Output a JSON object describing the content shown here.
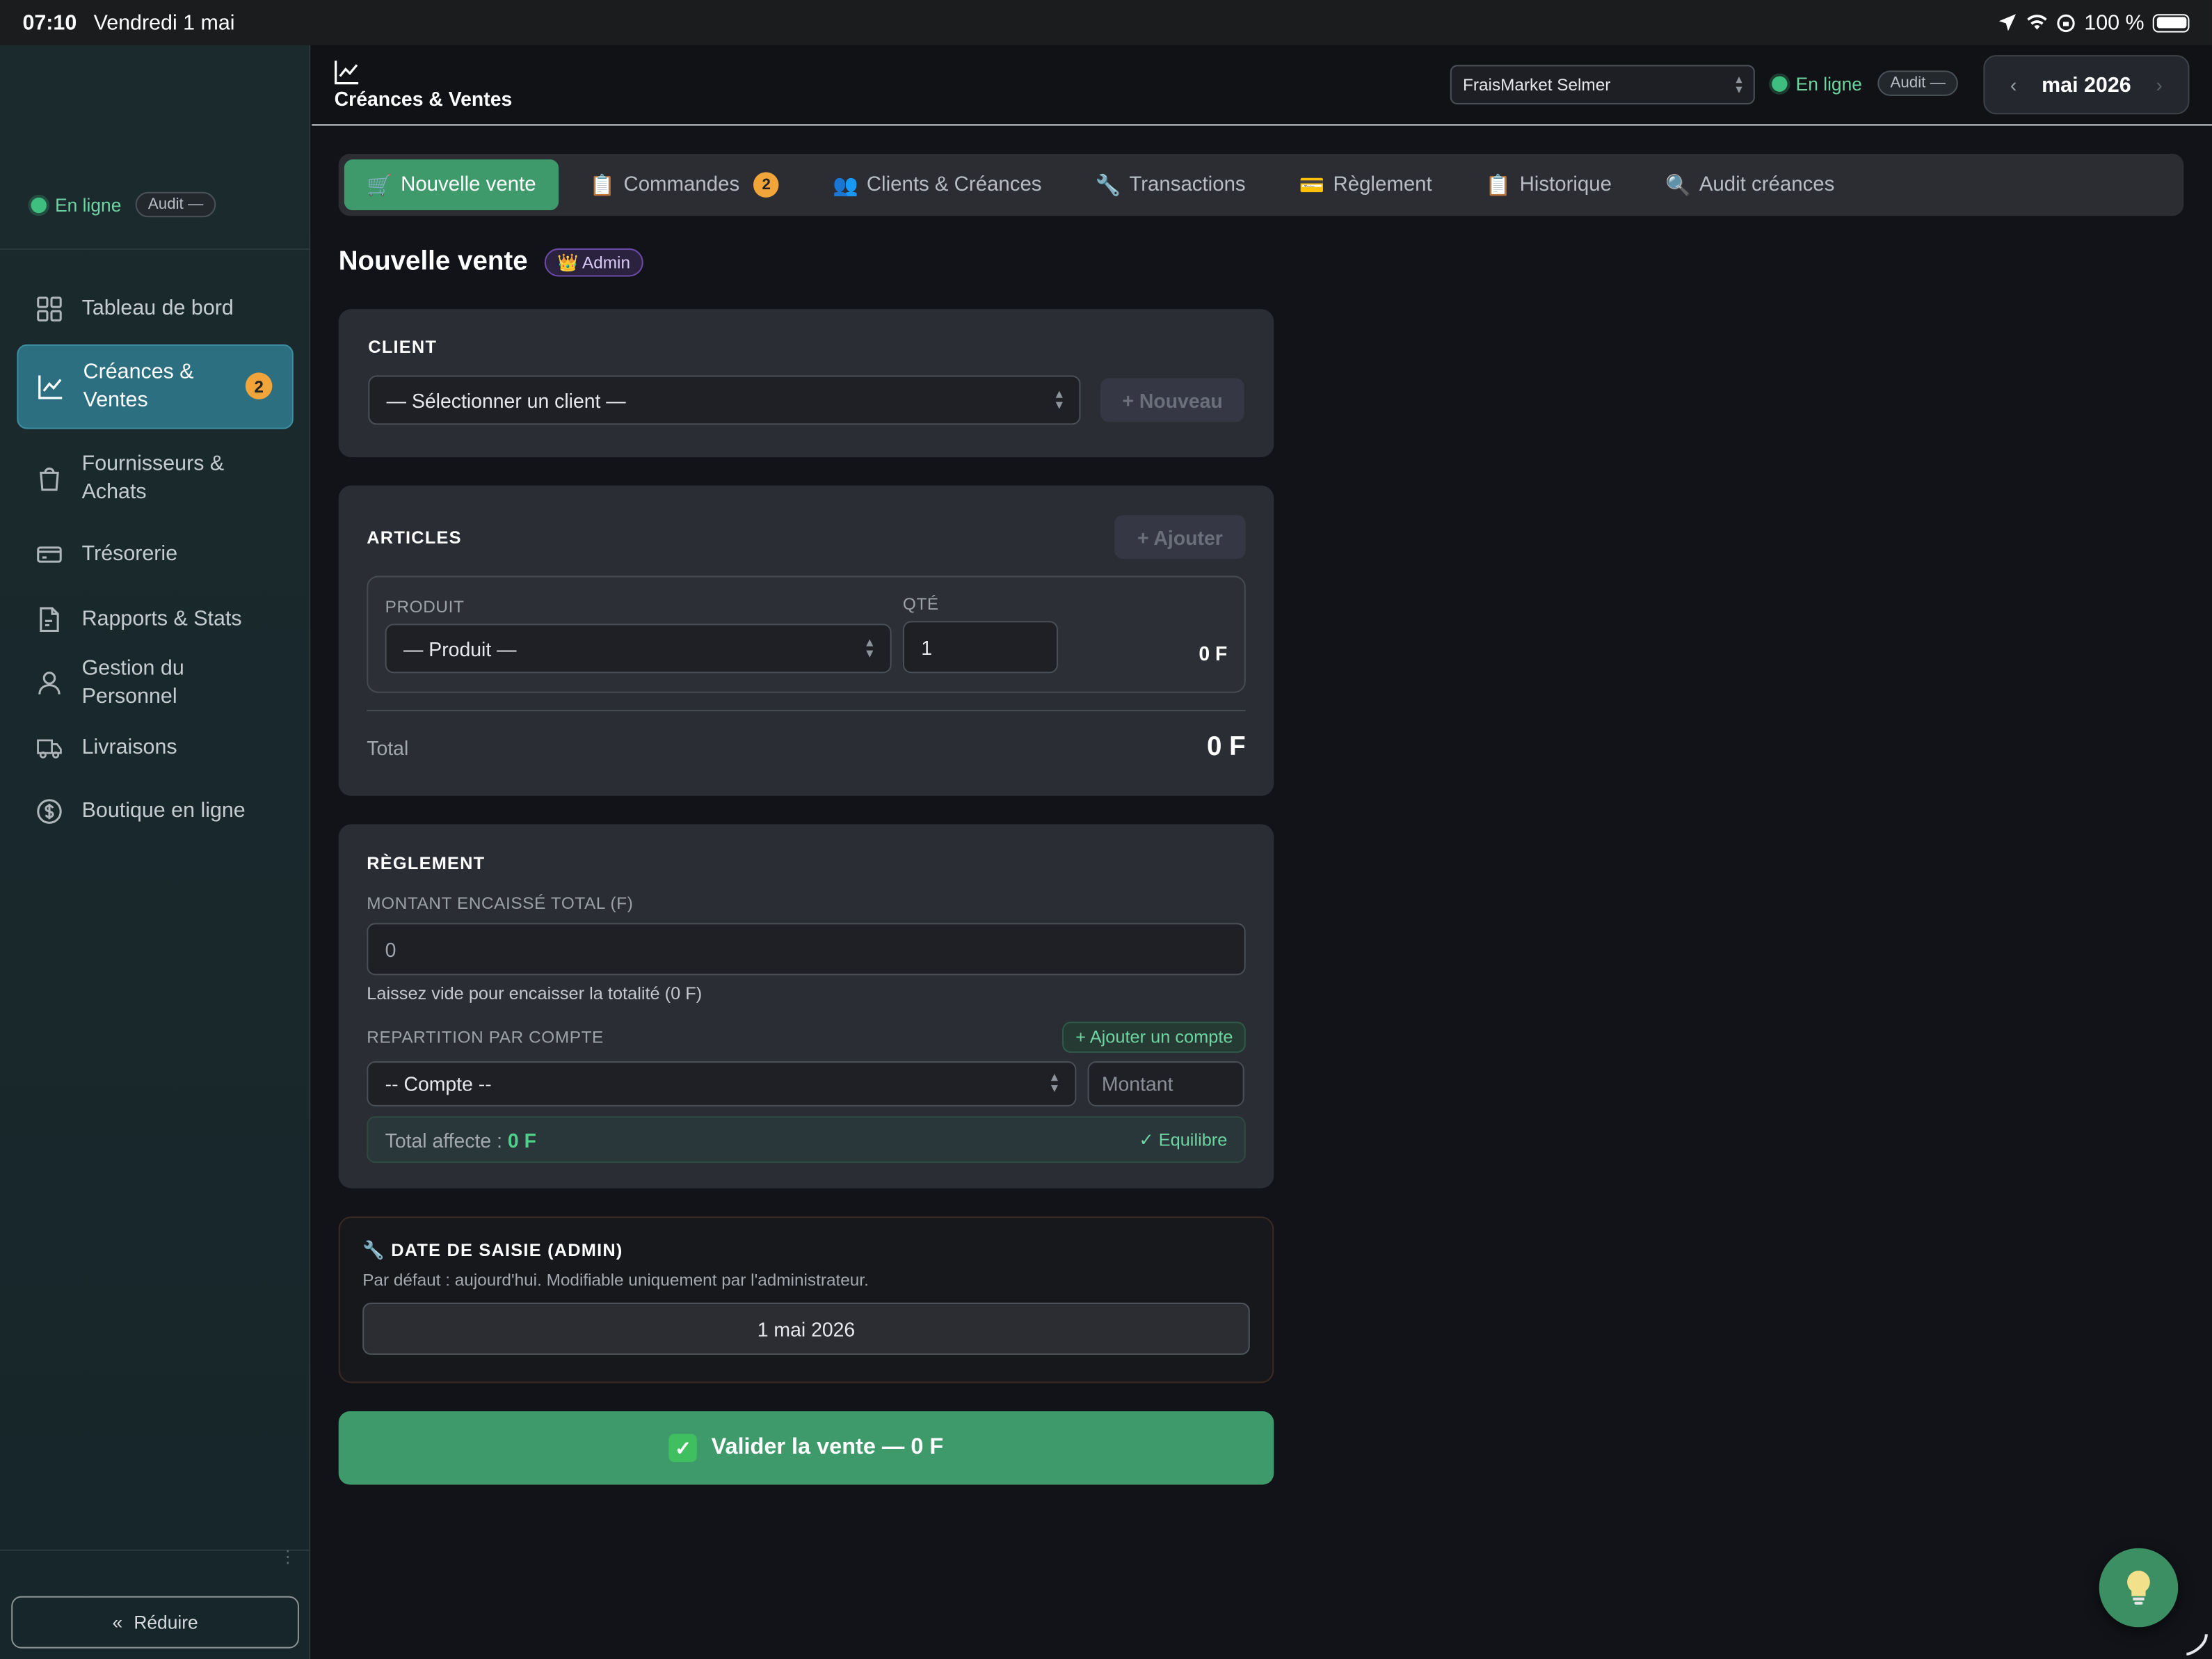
{
  "status_bar": {
    "time": "07:10",
    "date": "Vendredi 1 mai",
    "battery": "100 %"
  },
  "sidebar": {
    "online_label": "En ligne",
    "audit_label": "Audit —",
    "items": [
      {
        "label": "Tableau de bord",
        "icon": "grid-icon"
      },
      {
        "label": "Créances & Ventes",
        "icon": "chart-line-icon",
        "badge": "2",
        "active": true
      },
      {
        "label": "Fournisseurs & Achats",
        "icon": "bag-icon"
      },
      {
        "label": "Trésorerie",
        "icon": "cash-icon"
      },
      {
        "label": "Rapports & Stats",
        "icon": "document-icon"
      },
      {
        "label": "Gestion du Personnel",
        "icon": "user-icon"
      },
      {
        "label": "Livraisons",
        "icon": "truck-icon"
      },
      {
        "label": "Boutique en ligne",
        "icon": "dollar-circle-icon"
      }
    ],
    "reduce_label": "Réduire"
  },
  "topbar": {
    "title": "Créances & Ventes",
    "store": "FraisMarket Selmer",
    "online_label": "En ligne",
    "audit_label": "Audit —",
    "month": "mai 2026"
  },
  "tabs": [
    {
      "icon": "🛒",
      "label": "Nouvelle vente",
      "active": true
    },
    {
      "icon": "📋",
      "label": "Commandes",
      "badge": "2"
    },
    {
      "icon": "👥",
      "label": "Clients & Créances"
    },
    {
      "icon": "🔧",
      "label": "Transactions"
    },
    {
      "icon": "💳",
      "label": "Règlement"
    },
    {
      "icon": "📋",
      "label": "Historique"
    },
    {
      "icon": "🔍",
      "label": "Audit créances"
    }
  ],
  "page": {
    "title": "Nouvelle vente",
    "role_badge": "👑 Admin"
  },
  "client": {
    "heading": "CLIENT",
    "select": "— Sélectionner un client —",
    "new_button": "+ Nouveau"
  },
  "articles": {
    "heading": "ARTICLES",
    "add_button": "+ Ajouter",
    "product_label": "PRODUIT",
    "product_select": "— Produit —",
    "qty_label": "QTÉ",
    "qty_value": "1",
    "line_total": "0 F",
    "total_label": "Total",
    "total_value": "0 F"
  },
  "reglement": {
    "heading": "RÈGLEMENT",
    "amount_label": "MONTANT ENCAISSÉ TOTAL (F)",
    "amount_value": "0",
    "hint": "Laissez vide pour encaisser la totalité (0 F)",
    "repartition_label": "REPARTITION PAR COMPTE",
    "add_account_button": "+ Ajouter un compte",
    "account_select": "-- Compte --",
    "amount_placeholder": "Montant",
    "total_affecte_label": "Total affecte :",
    "total_affecte_value": "0 F",
    "balance_status": "✓ Equilibre"
  },
  "date_saisie": {
    "heading": "🔧 DATE DE SAISIE (ADMIN)",
    "hint": "Par défaut : aujourd'hui. Modifiable uniquement par l'administrateur.",
    "value": "1 mai 2026"
  },
  "submit": {
    "label": "Valider la vente — 0 F"
  },
  "colors": {
    "accent": "#3e9a6a",
    "sidebar_active": "#2b6f80",
    "badge": "#f0a43a",
    "online": "#3fbf7f"
  }
}
